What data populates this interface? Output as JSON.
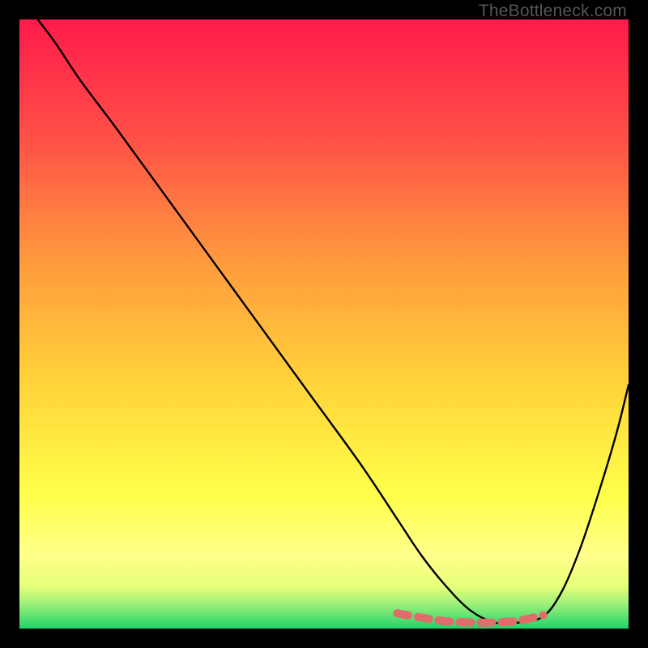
{
  "watermark": "TheBottleneck.com",
  "chart_data": {
    "type": "line",
    "title": "",
    "xlabel": "",
    "ylabel": "",
    "xlim": [
      0,
      100
    ],
    "ylim": [
      0,
      100
    ],
    "grid": false,
    "legend": false,
    "gradient_stops": [
      {
        "offset": 0.0,
        "color": "#ff1a4b"
      },
      {
        "offset": 0.2,
        "color": "#ff5247"
      },
      {
        "offset": 0.4,
        "color": "#ff9b3d"
      },
      {
        "offset": 0.6,
        "color": "#ffd43a"
      },
      {
        "offset": 0.78,
        "color": "#ffff4a"
      },
      {
        "offset": 0.88,
        "color": "#ffff8a"
      },
      {
        "offset": 0.93,
        "color": "#e8ff7a"
      },
      {
        "offset": 0.96,
        "color": "#9cf07a"
      },
      {
        "offset": 1.0,
        "color": "#1fd36a"
      }
    ],
    "series": [
      {
        "name": "bottleneck-curve",
        "color": "#000000",
        "x": [
          3,
          6,
          10,
          16,
          24,
          32,
          40,
          48,
          56,
          62,
          66,
          70,
          74,
          78,
          82,
          86,
          89,
          92,
          95,
          98,
          100
        ],
        "y": [
          100,
          96,
          90,
          82,
          71,
          60,
          49,
          38,
          27,
          18,
          12,
          7,
          3,
          1,
          1,
          2,
          6,
          13,
          22,
          32,
          40
        ]
      }
    ],
    "overlay_segments": [
      {
        "name": "flat-region-highlight",
        "color": "#e26b6b",
        "x": [
          62,
          66,
          70,
          74,
          78,
          82,
          86
        ],
        "y": [
          2.5,
          1.8,
          1.2,
          1.0,
          1.0,
          1.3,
          2.2
        ]
      }
    ]
  }
}
